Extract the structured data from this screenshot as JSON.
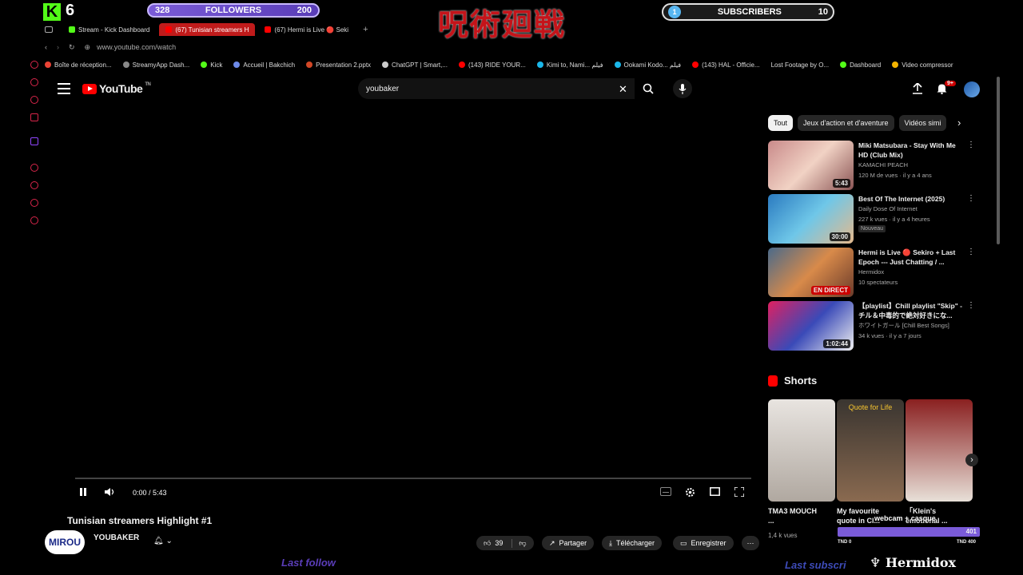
{
  "overlay": {
    "kick_count": "6",
    "followers": {
      "current": "328",
      "label": "FOLLOWERS",
      "goal": "200"
    },
    "subscribers": {
      "current": "1",
      "label": "SUBSCRIBERS",
      "goal": "10"
    },
    "logo_text": "呪術廻戦",
    "sub_goal": {
      "label": "webcam + casque",
      "value": "401",
      "start": "TND 0",
      "end": "TND 400"
    },
    "last_follow_label": "Last follow",
    "last_sub_label": "Last subscri",
    "streamer_name": "Hermidox",
    "mirou_badge": "MIROU"
  },
  "browser": {
    "tabs": [
      {
        "label": "Stream - Kick Dashboard",
        "active": false,
        "color": "#53fc18"
      },
      {
        "label": "(67) Tunisian streamers H",
        "active": true,
        "color": "#ff0000"
      },
      {
        "label": "(67) Hermi is Live 🔴 Seki",
        "active": false,
        "color": "#ff0000"
      }
    ],
    "url": "www.youtube.com/watch",
    "bookmarks": [
      {
        "label": "Boîte de réception...",
        "color": "#ea4335"
      },
      {
        "label": "StreamyApp Dash...",
        "color": "#888888"
      },
      {
        "label": "Kick",
        "color": "#53fc18"
      },
      {
        "label": "Accueil | Bakchich",
        "color": "#6d8ae8"
      },
      {
        "label": "Presentation 2.pptx",
        "color": "#d24726"
      },
      {
        "label": "ChatGPT | Smart,...",
        "color": "#cccccc"
      },
      {
        "label": "(143) RIDE YOUR...",
        "color": "#ff0000"
      },
      {
        "label": "Kimi to, Nami... فيلم",
        "color": "#1ab7ea"
      },
      {
        "label": "Ookami Kodo... فيلم",
        "color": "#1ab7ea"
      },
      {
        "label": "(143) HAL - Officie...",
        "color": "#ff0000"
      },
      {
        "label": "Lost Footage by O...",
        "color": "#888888"
      },
      {
        "label": "Dashboard",
        "color": "#53fc18"
      },
      {
        "label": "Video compressor",
        "color": "#f4b400"
      }
    ]
  },
  "youtube": {
    "logo": "YouTube",
    "logo_tm": "TN",
    "search_value": "youbaker",
    "notif_count": "9+",
    "player": {
      "time": "0:00 / 5:43",
      "progress": 0.0
    },
    "video_title": "Tunisian streamers Highlight #1",
    "channel": "YOUBAKER",
    "actions": {
      "likes": "39",
      "share": "Partager",
      "download": "Télécharger",
      "save": "Enregistrer"
    },
    "chips": [
      "Tout",
      "Jeux d'action et d'aventure",
      "Vidéos simi"
    ],
    "recommendations": [
      {
        "title": "Miki Matsubara - Stay With Me HD (Club Mix)",
        "channel": "KAMACHI PEACH",
        "meta": "120 M de vues · il y a 4 ans",
        "duration": "5:43",
        "badge": "",
        "live": false,
        "thumb": "linear-gradient(135deg,#c98a8a,#f1d2c4,#8a5454)"
      },
      {
        "title": "Best Of The Internet (2025)",
        "channel": "Daily Dose Of Internet",
        "meta": "227 k vues · il y a 4 heures",
        "duration": "30:00",
        "badge": "Nouveau",
        "live": false,
        "thumb": "linear-gradient(135deg,#2a7ac0,#6fc7e8,#e5b98c)"
      },
      {
        "title": "Hermi is Live 🔴 Sekiro + Last Epoch --- Just Chatting / ...",
        "channel": "Hermidox",
        "meta": "10 spectateurs",
        "duration": "EN DIRECT",
        "badge": "",
        "live": true,
        "thumb": "linear-gradient(135deg,#4a6a8a,#d88a4a,#6a3a2a)"
      },
      {
        "title": "【playlist】Chill playlist \"Skip\" - チル＆中毒的で絶対好きにな...",
        "channel": "ホワイトガール [Chill Best Songs]",
        "meta": "34 k vues · il y a 7 jours",
        "duration": "1:02:44",
        "badge": "",
        "live": false,
        "thumb": "linear-gradient(135deg,#e02060,#3a4ab8,#f0f0f0)"
      }
    ],
    "shorts_label": "Shorts",
    "shorts": [
      {
        "title": "TMA3 MOUCH ...",
        "meta": "1,4 k vues",
        "caption": "",
        "thumb": "linear-gradient(180deg,#e8e4e0,#b0a8a0)"
      },
      {
        "title": "My favourite quote in Cl...",
        "meta": "",
        "caption": "Quote for Life",
        "thumb": "linear-gradient(180deg,#3a3530,#8a6a50)"
      },
      {
        "title": "「Klein's emotional ...",
        "meta": "",
        "caption": "",
        "thumb": "linear-gradient(180deg,#8a2020,#e8e0d8)"
      }
    ]
  }
}
